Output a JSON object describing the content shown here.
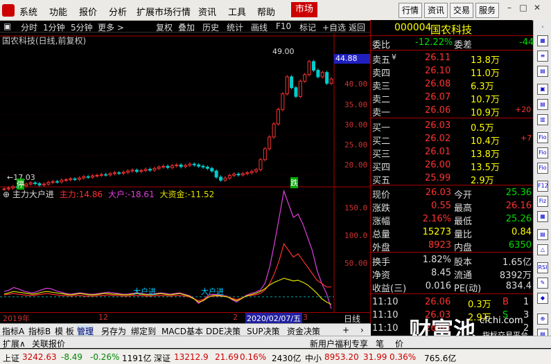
{
  "menu": {
    "items": [
      "系统",
      "功能",
      "报价",
      "分析",
      "扩展市场行情",
      "资讯",
      "工具",
      "帮助"
    ],
    "market": "市场",
    "right_buttons": [
      "行情",
      "资讯",
      "交易",
      "服务"
    ]
  },
  "toolbar": {
    "items": [
      "分时",
      "1分钟",
      "5分钟",
      "更多 >",
      "复权",
      "叠加",
      "历史",
      "统计",
      "画线",
      "F10",
      "标记",
      "+自选",
      "返回"
    ]
  },
  "chart": {
    "title": "国农科技(日线,前复权)",
    "price_ticks": [
      "44.88",
      "40.00",
      "35.00",
      "30.00",
      "25.00",
      "20.00"
    ],
    "high_label": "49.00",
    "low_label": "17.03",
    "badge_up": "停",
    "badge_down": "跌",
    "indicator_title": "主力大户进",
    "ind_labels": [
      {
        "name": "主力:",
        "value": "14.86"
      },
      {
        "name": "大户:",
        "value": "-18.61"
      },
      {
        "name": "大资金:",
        "value": "-11.52"
      }
    ],
    "ind_ticks": [
      "150.0",
      "100.0",
      "50.00"
    ],
    "date_labels": [
      "2019年",
      "12",
      "2",
      "2020/02/07/五",
      "3"
    ],
    "ind_text": [
      "大户进",
      "大户进"
    ],
    "period_label": "日线",
    "colors": {
      "zhuli": "#ff3030",
      "dahu": "#e040e0",
      "dazijin": "#e0e000"
    }
  },
  "chart_data": {
    "type": "line",
    "title": "国农科技(日线,前复权)",
    "ylim": [
      17,
      50
    ],
    "close": [
      17.8,
      18.0,
      18.3,
      18.1,
      18.5,
      18.9,
      19.2,
      19.0,
      18.7,
      18.9,
      19.3,
      19.5,
      19.4,
      19.8,
      19.9,
      20.1,
      20.0,
      20.3,
      20.6,
      20.5,
      20.8,
      20.9,
      21.1,
      21.0,
      21.3,
      21.5,
      21.4,
      21.6,
      21.9,
      22.1,
      21.8,
      22.0,
      22.3,
      22.1,
      22.5,
      22.8,
      23.0,
      22.7,
      23.1,
      23.3,
      22.9,
      23.2,
      23.5,
      23.3,
      23.0,
      22.8,
      22.5,
      21.9,
      20.5,
      19.8,
      20.3,
      20.9,
      21.2,
      21.0,
      21.3,
      21.5,
      21.8,
      22.2,
      24.5,
      27.0,
      29.7,
      32.7,
      36.0,
      39.6,
      43.5,
      41.0,
      39.0,
      42.5,
      44.0,
      47.0,
      45.0,
      43.5,
      44.5,
      42.0,
      43.0
    ],
    "dahu": [
      8,
      10,
      14,
      12,
      9,
      7,
      6,
      8,
      11,
      13,
      12,
      9,
      7,
      5,
      4,
      5,
      6,
      5,
      4,
      4,
      5,
      6,
      7,
      6,
      5,
      4,
      4,
      5,
      6,
      5,
      4,
      4,
      5,
      6,
      5,
      4,
      5,
      6,
      4,
      2,
      -2,
      -10,
      -5,
      2,
      4,
      3,
      2,
      1,
      -4,
      -8,
      -3,
      2,
      5,
      7,
      10,
      20,
      45,
      80,
      120,
      160,
      140,
      120,
      125,
      110,
      90,
      70,
      40,
      20,
      5,
      -18
    ],
    "zhuli": [
      3,
      4,
      5,
      4,
      3,
      2,
      2,
      3,
      4,
      5,
      4,
      3,
      2,
      2,
      1,
      2,
      2,
      1,
      1,
      1,
      2,
      2,
      3,
      2,
      2,
      1,
      1,
      2,
      2,
      2,
      1,
      1,
      2,
      2,
      2,
      1,
      2,
      2,
      1,
      0,
      -3,
      -6,
      -4,
      0,
      1,
      1,
      1,
      0,
      -2,
      -4,
      -2,
      1,
      2,
      3,
      5,
      10,
      20,
      35,
      55,
      80,
      70,
      60,
      65,
      55,
      45,
      35,
      25,
      20,
      15,
      14.86
    ],
    "dazijin": [
      4,
      6,
      8,
      7,
      6,
      5,
      4,
      5,
      7,
      8,
      7,
      6,
      5,
      4,
      3,
      4,
      5,
      4,
      3,
      3,
      4,
      5,
      5,
      4,
      4,
      3,
      3,
      4,
      5,
      4,
      3,
      3,
      4,
      5,
      4,
      3,
      4,
      5,
      3,
      1,
      -3,
      -8,
      -6,
      -1,
      2,
      2,
      1,
      0,
      -3,
      -6,
      -3,
      1,
      3,
      5,
      8,
      12,
      18,
      22,
      25,
      28,
      26,
      24,
      25,
      22,
      18,
      12,
      5,
      -3,
      -8,
      -11.52
    ]
  },
  "quote": {
    "code": "000004",
    "name": "国农科技",
    "weibi_label": "委比",
    "weibi": "-12.22%",
    "weicha_label": "委差",
    "weicha": "-44",
    "sells": [
      {
        "label": "卖五",
        "flag": "¥",
        "price": "26.11",
        "vol": "13.8万",
        "chg": ""
      },
      {
        "label": "卖四",
        "flag": "",
        "price": "26.10",
        "vol": "11.0万",
        "chg": ""
      },
      {
        "label": "卖三",
        "flag": "",
        "price": "26.08",
        "vol": "6.3万",
        "chg": ""
      },
      {
        "label": "卖二",
        "flag": "",
        "price": "26.07",
        "vol": "10.7万",
        "chg": ""
      },
      {
        "label": "卖一",
        "flag": "",
        "price": "26.06",
        "vol": "10.9万",
        "chg": "+20"
      }
    ],
    "buys": [
      {
        "label": "买一",
        "price": "26.03",
        "vol": "0.5万",
        "chg": ""
      },
      {
        "label": "买二",
        "price": "26.02",
        "vol": "10.4万",
        "chg": "+7"
      },
      {
        "label": "买三",
        "price": "26.01",
        "vol": "13.8万",
        "chg": ""
      },
      {
        "label": "买四",
        "price": "26.00",
        "vol": "13.5万",
        "chg": ""
      },
      {
        "label": "买五",
        "price": "25.99",
        "vol": "2.9万",
        "chg": ""
      }
    ],
    "stats": [
      {
        "l1": "现价",
        "v1": "26.03",
        "l2": "今开",
        "v2": "25.36"
      },
      {
        "l1": "涨跌",
        "v1": "0.55",
        "l2": "最高",
        "v2": "26.16"
      },
      {
        "l1": "涨幅",
        "v1": "2.16%",
        "l2": "最低",
        "v2": "25.26"
      },
      {
        "l1": "总量",
        "v1": "15273",
        "l2": "量比",
        "v2": "0.84"
      },
      {
        "l1": "外盘",
        "v1": "8923",
        "l2": "内盘",
        "v2": "6350"
      }
    ],
    "stats2": [
      {
        "l1": "换手",
        "v1": "1.82%",
        "l2": "股本",
        "v2": "1.65亿"
      },
      {
        "l1": "净资",
        "v1": "8.45",
        "l2": "流通",
        "v2": "8392万"
      },
      {
        "l1": "收益(三)",
        "v1": "0.016",
        "l2": "PE(动)",
        "v2": "834.4"
      }
    ],
    "ticks": [
      {
        "time": "11:10",
        "price": "26.06",
        "vol": "0.3万",
        "side": "B",
        "n": "1"
      },
      {
        "time": "11:10",
        "price": "26.03",
        "vol": "2.9万",
        "side": "S",
        "n": "3"
      },
      {
        "time": "11:10",
        "price": "26.03",
        "vol": "",
        "side": "",
        "n": "2"
      }
    ]
  },
  "tabs": {
    "items": [
      "指标A",
      "指标B",
      "模 板",
      "管理",
      "另存为",
      "绑定到",
      "MACD基本",
      "DDE决策",
      "SUP决策",
      "资金决策"
    ],
    "plus": "+",
    "chevron": "›"
  },
  "tabs2": {
    "left": [
      "扩展∧",
      "关联报价"
    ],
    "right": "新用户福利专享",
    "tail": [
      "笔",
      "价"
    ]
  },
  "status": {
    "sh_label": "上证",
    "sh_idx": "3242.63",
    "sh_chg": "-8.49",
    "sh_pct": "-0.26%",
    "sh_amt": "1191亿",
    "sz_label": "深证",
    "sz_idx": "13212.9",
    "sz_chg": "21.69",
    "sz_pct": "0.16%",
    "sz_amt": "2430亿",
    "zx_label": "中小",
    "zx_idx": "8953.20",
    "zx_chg": "31.99",
    "zx_pct": "0.36%",
    "zx_amt": "765.6亿"
  },
  "watermark": {
    "text": "财富池",
    "url": "cfchi.com",
    "sub": "指标交易平台"
  }
}
